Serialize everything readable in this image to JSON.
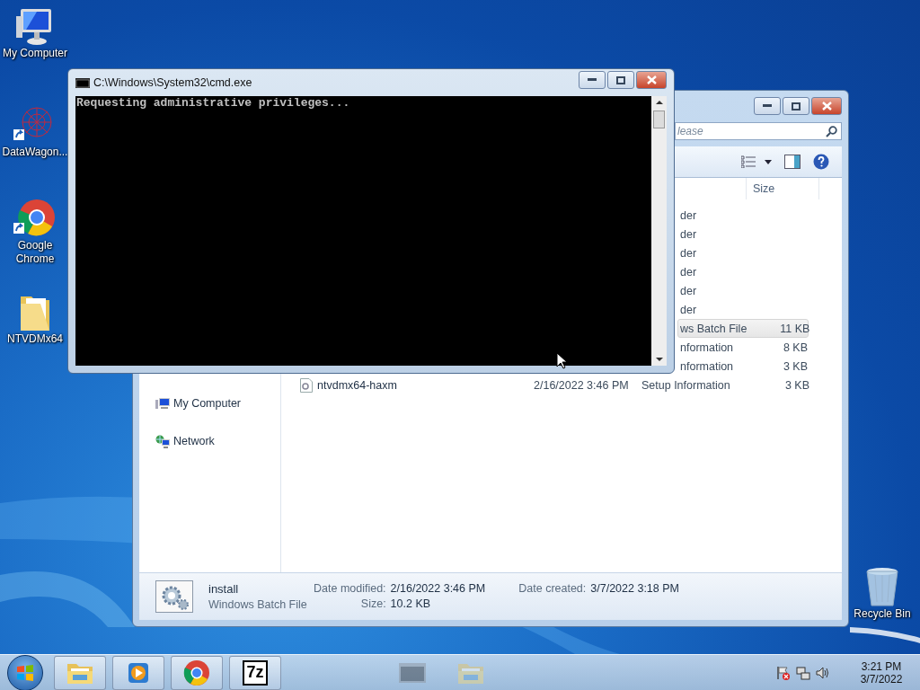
{
  "desktop_icons": [
    {
      "label": "My Computer",
      "kind": "computer",
      "shortcut": false
    },
    {
      "label": "DataWagon...",
      "kind": "web",
      "shortcut": true
    },
    {
      "label": "Google Chrome",
      "kind": "chrome",
      "shortcut": true
    },
    {
      "label": "NTVDMx64",
      "kind": "folder",
      "shortcut": false
    }
  ],
  "recycle_bin": {
    "label": "Recycle Bin"
  },
  "explorer": {
    "search": {
      "placeholder": "lease"
    },
    "columns": [
      {
        "label": "Size"
      }
    ],
    "rows": [
      {
        "kind": "partial",
        "type": "der",
        "selected": false
      },
      {
        "kind": "partial",
        "type": "der",
        "selected": false
      },
      {
        "kind": "partial",
        "type": "der",
        "selected": false
      },
      {
        "kind": "partial",
        "type": "der",
        "selected": false
      },
      {
        "kind": "partial",
        "type": "der",
        "selected": false
      },
      {
        "kind": "partial",
        "type": "der",
        "selected": false
      },
      {
        "kind": "partial",
        "type": "ws Batch File",
        "size": "11 KB",
        "selected": true
      },
      {
        "kind": "partial",
        "type": "nformation",
        "size": "8 KB",
        "selected": false
      },
      {
        "kind": "partial",
        "type": "nformation",
        "size": "3 KB",
        "selected": false
      },
      {
        "kind": "full",
        "name": "ntvdmx64-haxm",
        "date": "2/16/2022 3:46 PM",
        "type": "Setup Information",
        "size": "3 KB",
        "selected": false
      }
    ],
    "nav": [
      {
        "label": "My Computer",
        "kind": "computer"
      },
      {
        "label": "Network",
        "kind": "network"
      }
    ],
    "details": {
      "name": "install",
      "type": "Windows Batch File",
      "fields": [
        {
          "label": "Date modified:",
          "value": "2/16/2022 3:46 PM"
        },
        {
          "label": "Size:",
          "value": "10.2 KB"
        },
        {
          "label": "Date created:",
          "value": "3/7/2022 3:18 PM"
        }
      ]
    }
  },
  "cmd": {
    "title": "C:\\Windows\\System32\\cmd.exe",
    "output": "Requesting administrative privileges..."
  },
  "taskbar": {
    "pinned": [
      {
        "kind": "explorer"
      },
      {
        "kind": "media"
      },
      {
        "kind": "chrome"
      },
      {
        "kind": "sevenzip",
        "label": "7z"
      }
    ],
    "tasks": [
      {
        "kind": "cmd"
      },
      {
        "kind": "explorer"
      }
    ],
    "clock": {
      "time": "3:21 PM",
      "date": "3/7/2022"
    }
  }
}
